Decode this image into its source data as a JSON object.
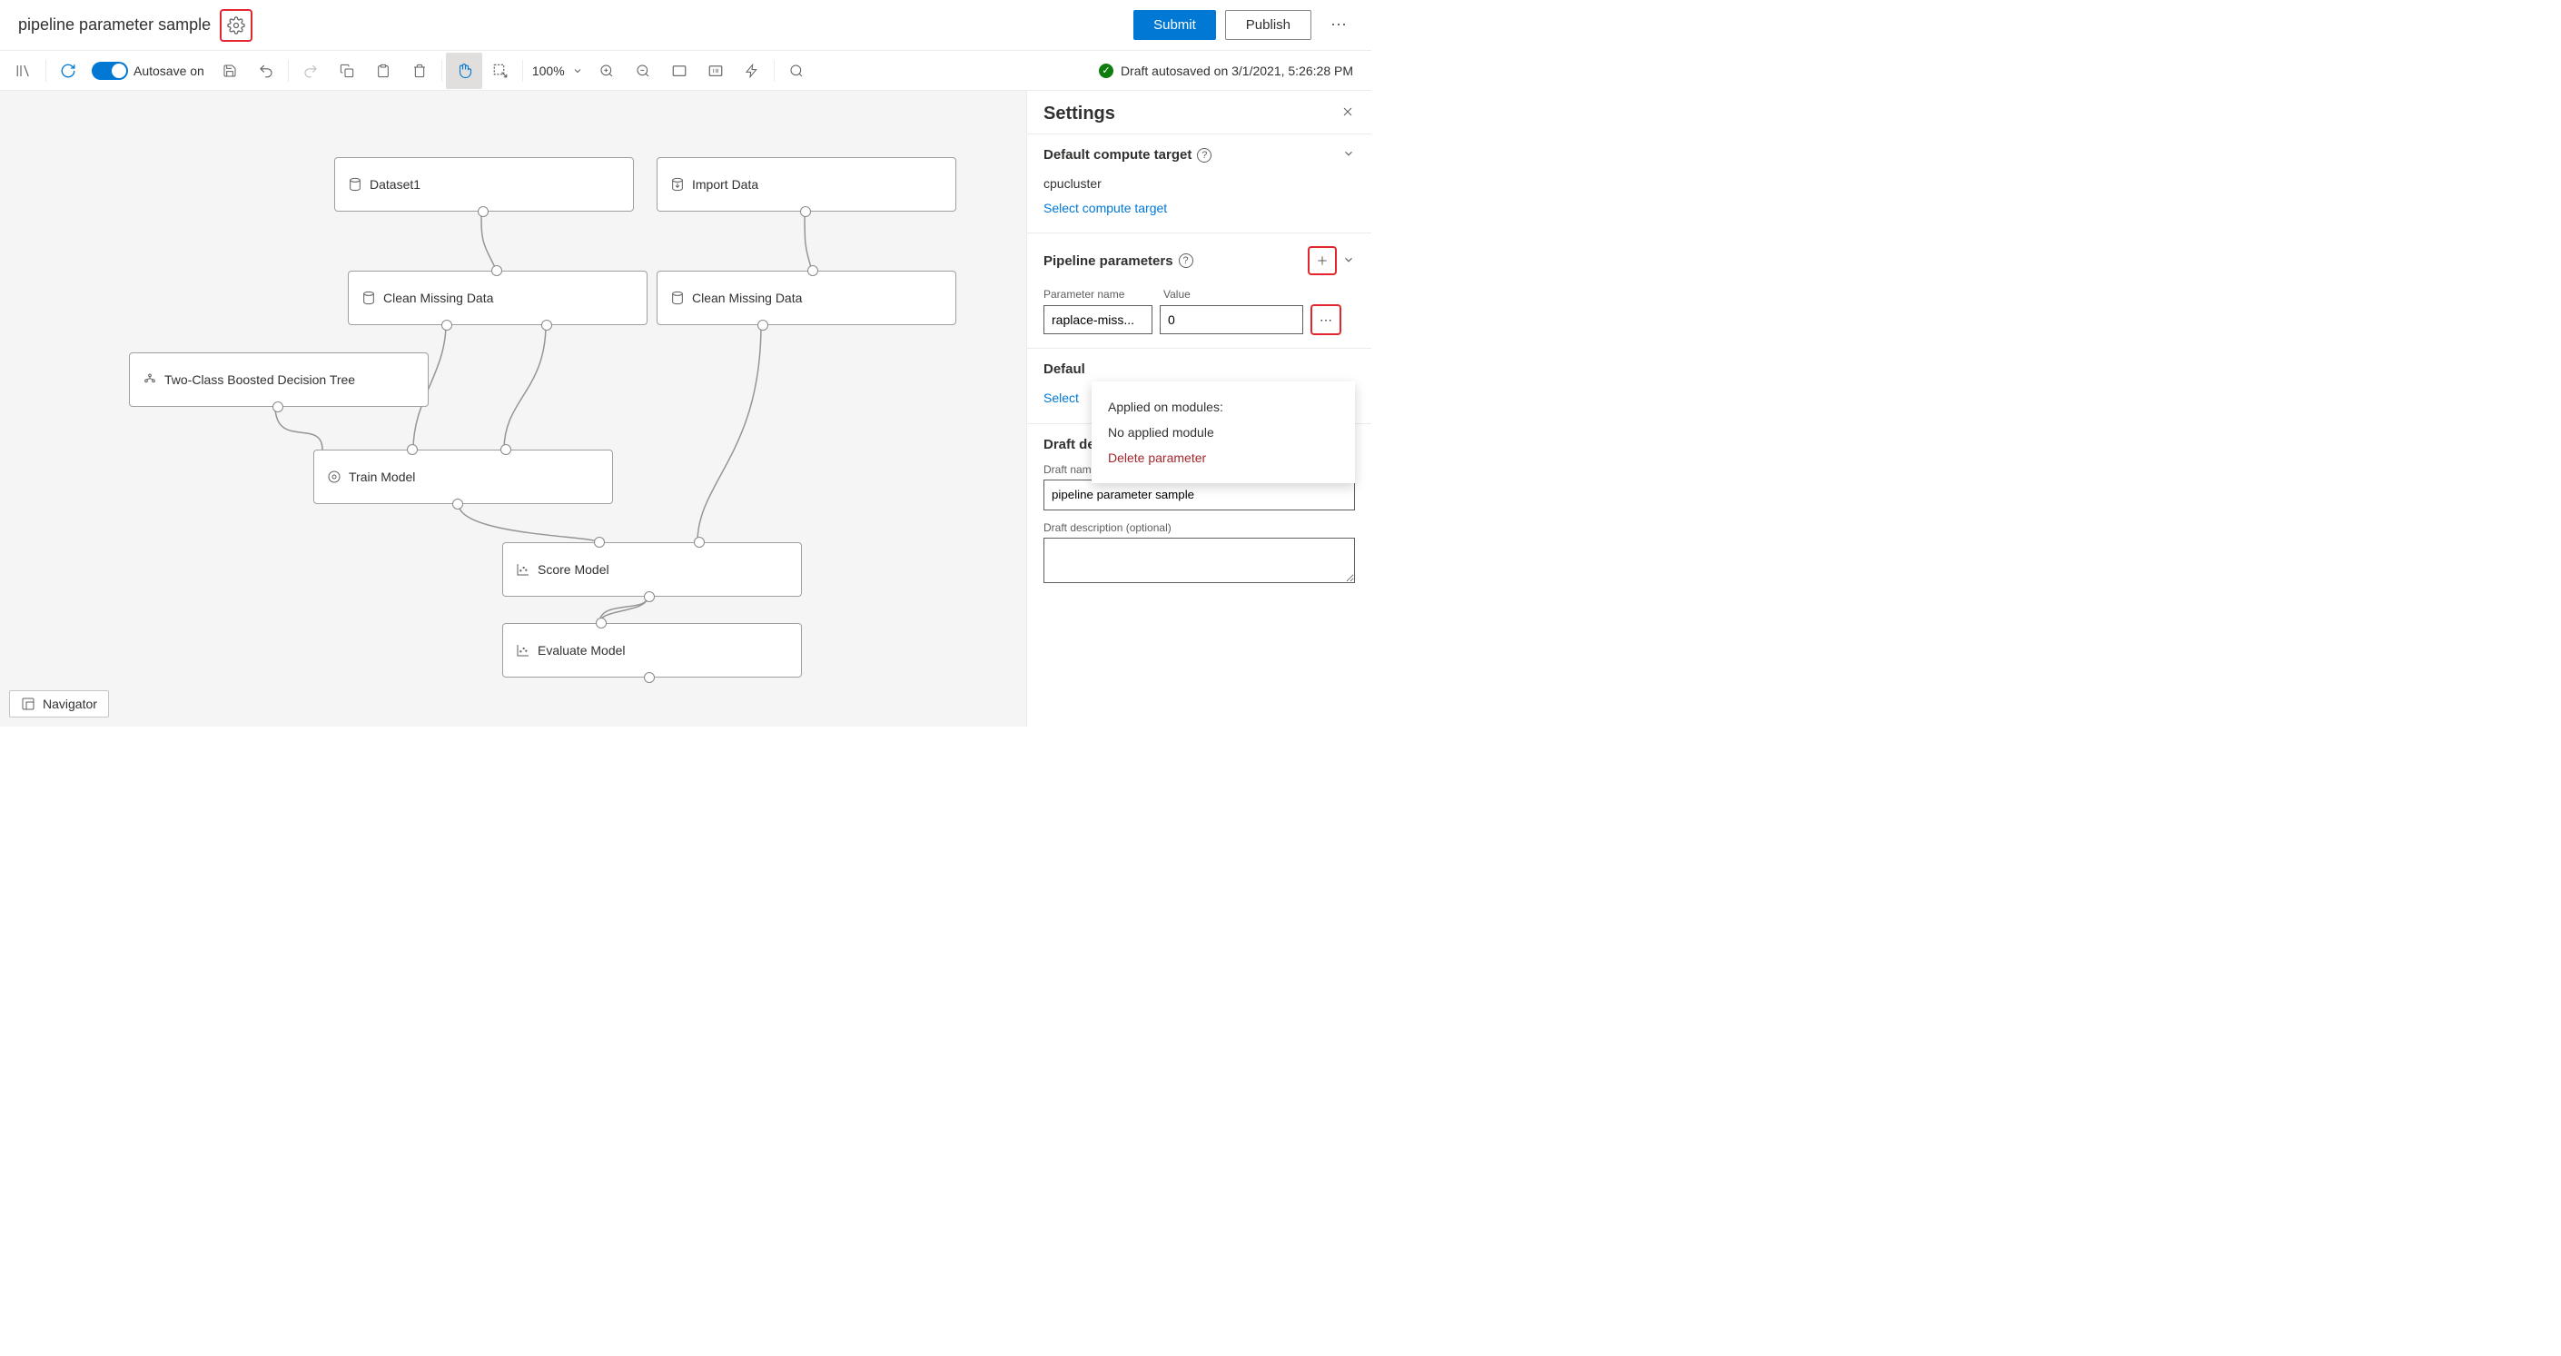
{
  "header": {
    "title": "pipeline parameter sample",
    "submit": "Submit",
    "publish": "Publish"
  },
  "toolbar": {
    "autosave_label": "Autosave on",
    "zoom": "100%"
  },
  "status": {
    "text": "Draft autosaved on 3/1/2021, 5:26:28 PM"
  },
  "nodes": {
    "dataset1": "Dataset1",
    "import_data": "Import Data",
    "clean1": "Clean Missing Data",
    "clean2": "Clean Missing Data",
    "tree": "Two-Class Boosted Decision Tree",
    "train": "Train Model",
    "score": "Score Model",
    "evaluate": "Evaluate Model"
  },
  "navigator": "Navigator",
  "panel": {
    "title": "Settings",
    "compute_section": "Default compute target",
    "compute_value": "cpucluster",
    "compute_link": "Select compute target",
    "params_section": "Pipeline parameters",
    "param_name_label": "Parameter name",
    "param_value_label": "Value",
    "param_name": "raplace-miss...",
    "param_value": "0",
    "flyout_applied": "Applied on modules:",
    "flyout_none": "No applied module",
    "flyout_delete": "Delete parameter",
    "datastore_section_prefix": "Defaul",
    "datastore_link_prefix": "Select ",
    "draft_section": "Draft details",
    "draft_name_label": "Draft name",
    "draft_name_value": "pipeline parameter sample",
    "draft_desc_label": "Draft description (optional)"
  }
}
